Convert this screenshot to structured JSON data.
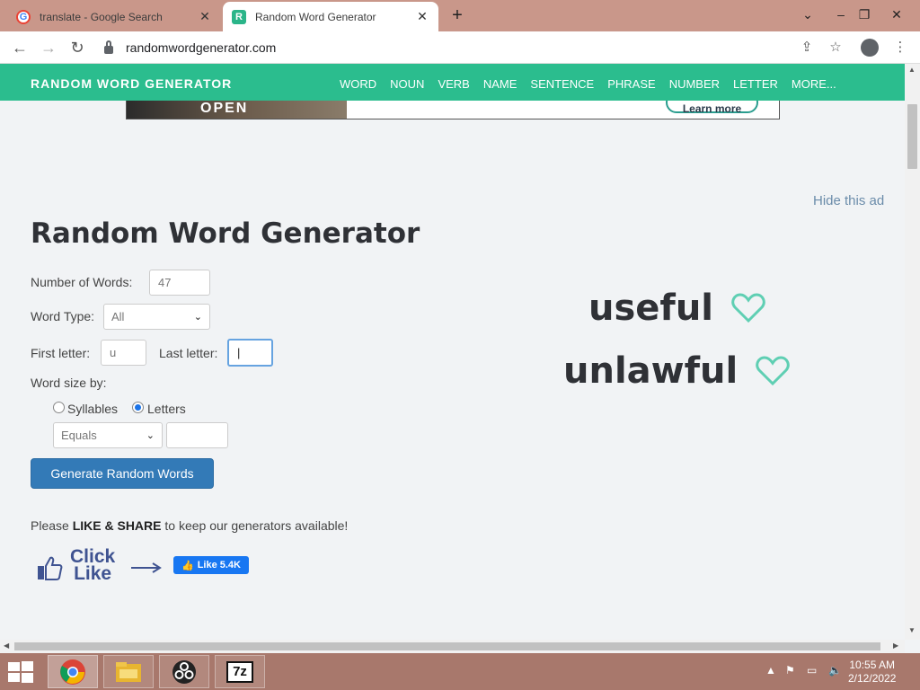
{
  "browser": {
    "tabs": [
      {
        "title": "translate - Google Search",
        "favicon": "G"
      },
      {
        "title": "Random Word Generator",
        "favicon": "R"
      }
    ],
    "url": "randomwordgenerator.com"
  },
  "site": {
    "brand": "RANDOM WORD GENERATOR",
    "nav": [
      "WORD",
      "NOUN",
      "VERB",
      "NAME",
      "SENTENCE",
      "PHRASE",
      "NUMBER",
      "LETTER",
      "MORE..."
    ]
  },
  "ad": {
    "open_text": "OPEN",
    "learn_more": "Learn more",
    "hide": "Hide this ad"
  },
  "page": {
    "title": "Random Word Generator",
    "num_words_label": "Number of Words:",
    "num_words_value": "47",
    "word_type_label": "Word Type:",
    "word_type_value": "All",
    "first_letter_label": "First letter:",
    "first_letter_value": "u",
    "last_letter_label": "Last letter:",
    "last_letter_value": "",
    "word_size_label": "Word size by:",
    "syllables_label": "Syllables",
    "letters_label": "Letters",
    "size_mode_value": "Equals",
    "size_value": "",
    "generate_button": "Generate Random Words",
    "share_prefix": "Please ",
    "share_bold": "LIKE & SHARE",
    "share_suffix": " to keep our generators available!",
    "click_like_1": "Click",
    "click_like_2": "Like",
    "fb_like": "Like 5.4K"
  },
  "results": {
    "words": [
      "useful",
      "unlawful"
    ]
  },
  "taskbar": {
    "time": "10:55 AM",
    "date": "2/12/2022"
  },
  "colors": {
    "accent": "#2bbd8e",
    "button": "#337ab7",
    "heart": "#5fcfb3"
  }
}
